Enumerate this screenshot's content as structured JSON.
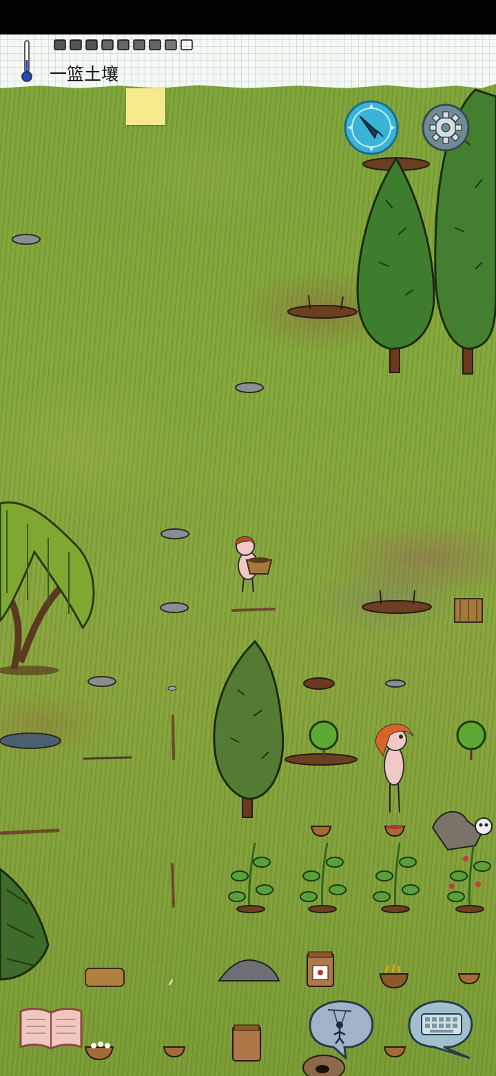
{
  "hud": {
    "hint_text": "一篮土壤",
    "food_pips_count": 9,
    "thermometer": "thermometer-icon",
    "sticky_note": "note-icon"
  },
  "controls": {
    "compass": "compass-icon",
    "settings": "gear-icon",
    "tech_book": "book-icon",
    "puppet": "puppet-icon",
    "keyboard": "keyboard-icon"
  },
  "colors": {
    "grass": "#86a83c",
    "compass_blue": "#3ab4d6",
    "gear_gray": "#6f8c96",
    "paper": "#f6f8f4",
    "sticky": "#f7ea8c"
  }
}
